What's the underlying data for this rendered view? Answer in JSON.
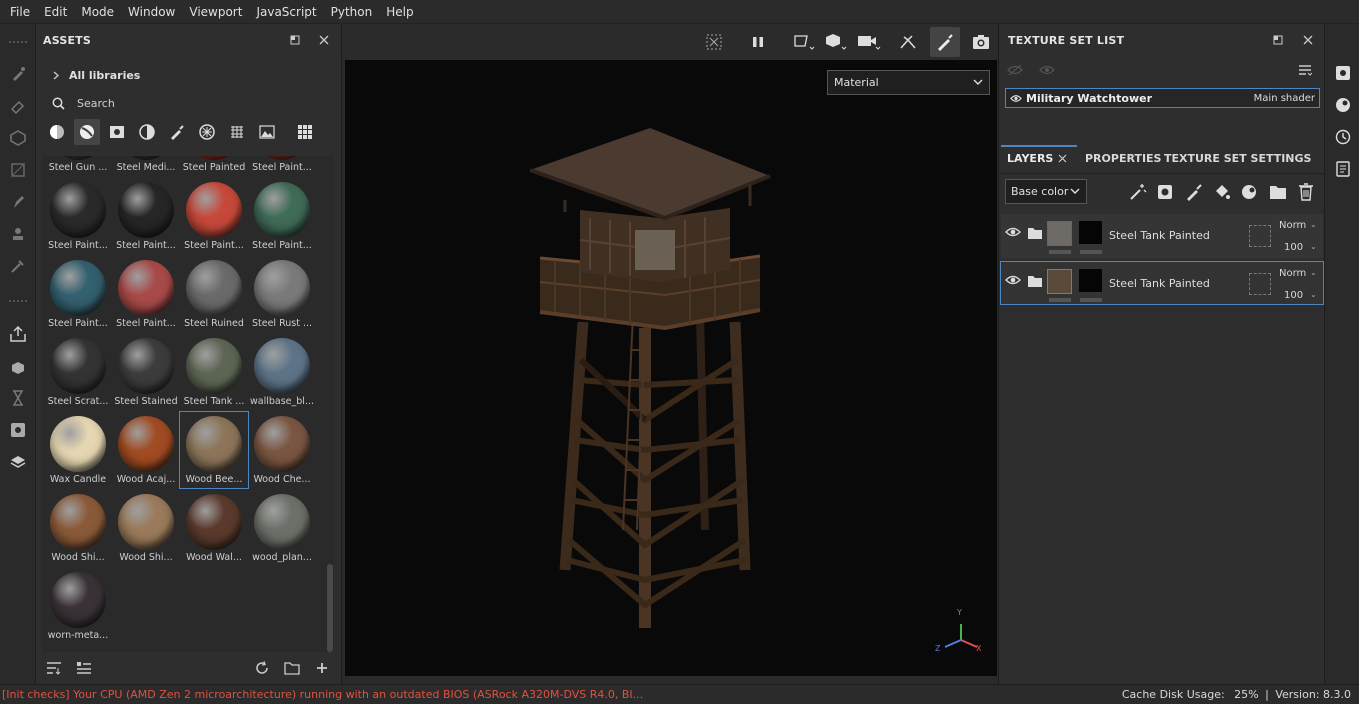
{
  "menu": [
    "File",
    "Edit",
    "Mode",
    "Window",
    "Viewport",
    "JavaScript",
    "Python",
    "Help"
  ],
  "assets": {
    "title": "ASSETS",
    "libraries_label": "All libraries",
    "search_placeholder": "Search",
    "tiles": [
      {
        "label": "Steel Gun ...",
        "color": "#3a3a3a"
      },
      {
        "label": "Steel Medi...",
        "color": "#2f3a36"
      },
      {
        "label": "Steel Painted",
        "color": "#9a2a22"
      },
      {
        "label": "Steel Paint...",
        "color": "#8a2a24"
      },
      {
        "label": "Steel Paint...",
        "color": "#2a2a2a"
      },
      {
        "label": "Steel Paint...",
        "color": "#262626"
      },
      {
        "label": "Steel Paint...",
        "color": "#c6483a"
      },
      {
        "label": "Steel Paint...",
        "color": "#3f6b57"
      },
      {
        "label": "Steel Paint...",
        "color": "#33606e"
      },
      {
        "label": "Steel Paint...",
        "color": "#a84a48"
      },
      {
        "label": "Steel Ruined",
        "color": "#6a6a6a"
      },
      {
        "label": "Steel Rust ...",
        "color": "#7a7a7a"
      },
      {
        "label": "Steel Scrat...",
        "color": "#333333"
      },
      {
        "label": "Steel Stained",
        "color": "#3c3c3c"
      },
      {
        "label": "Steel Tank ...",
        "color": "#5d6654"
      },
      {
        "label": "wallbase_bl...",
        "color": "#5d7488"
      },
      {
        "label": "Wax Candle",
        "color": "#e6d7b2"
      },
      {
        "label": "Wood Acaj...",
        "color": "#a14b22"
      },
      {
        "label": "Wood Bee...",
        "color": "#8c7559"
      },
      {
        "label": "Wood Che...",
        "color": "#7a5642"
      },
      {
        "label": "Wood Shi...",
        "color": "#8a5a38"
      },
      {
        "label": "Wood Shi...",
        "color": "#9a7a5a"
      },
      {
        "label": "Wood Wal...",
        "color": "#5a3a2c"
      },
      {
        "label": "wood_plan...",
        "color": "#6b7068"
      },
      {
        "label": "worn-meta...",
        "color": "#3a3238"
      }
    ],
    "selected_tile": 18
  },
  "viewport": {
    "material_mode": "Material",
    "axis": {
      "y": "Y",
      "x": "X",
      "z": "Z"
    }
  },
  "texture_set_list": {
    "title": "TEXTURE SET LIST",
    "item_name": "Military Watchtower",
    "item_shader": "Main shader"
  },
  "layers_panel": {
    "tabs": [
      "LAYERS",
      "PROPERTIES",
      "TEXTURE SET SETTINGS"
    ],
    "channel": "Base color",
    "layers": [
      {
        "name": "Steel Tank Painted",
        "blend": "Norm",
        "opacity": "100",
        "thumb_color": "#6e6a66"
      },
      {
        "name": "Steel Tank Painted",
        "blend": "Norm",
        "opacity": "100",
        "thumb_color": "#5a4a3a"
      }
    ]
  },
  "status": {
    "message": "[Init checks] Your CPU (AMD Zen 2 microarchitecture) running with an outdated BIOS (ASRock A320M-DVS R4.0, BI...",
    "cache_label": "Cache Disk Usage:",
    "cache_value": "25%",
    "version": "Version: 8.3.0"
  },
  "colors": {
    "accent": "#4e86c4",
    "error": "#e0513f"
  }
}
